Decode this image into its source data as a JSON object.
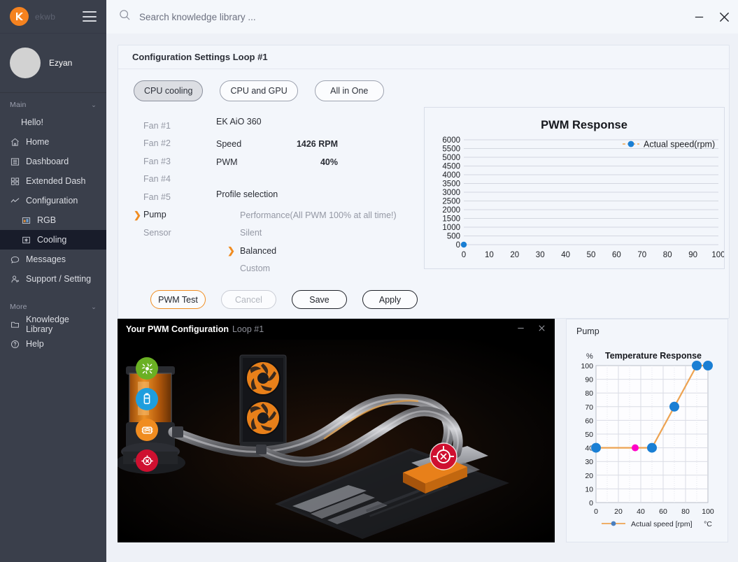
{
  "sidebar": {
    "brand": "ekwb",
    "user": "Ezyan",
    "section_main": "Main",
    "section_more": "More",
    "items_main": [
      {
        "label": "Hello!",
        "icon": "none"
      },
      {
        "label": "Home",
        "icon": "home-icon"
      },
      {
        "label": "Dashboard",
        "icon": "dashboard-icon"
      },
      {
        "label": "Extended Dash",
        "icon": "grid-icon"
      },
      {
        "label": "Configuration",
        "icon": "chart-icon"
      },
      {
        "label": "RGB",
        "icon": "rgb-icon"
      },
      {
        "label": "Cooling",
        "icon": "cooling-icon"
      },
      {
        "label": "Messages",
        "icon": "message-icon"
      },
      {
        "label": "Support / Setting",
        "icon": "support-icon"
      }
    ],
    "items_more": [
      {
        "label": "Knowledge Library",
        "icon": "folder-icon"
      },
      {
        "label": "Help",
        "icon": "help-icon"
      }
    ]
  },
  "topbar": {
    "search_placeholder": "Search knowledge library ...",
    "search_value": "",
    "minimize": "–",
    "close": "✕"
  },
  "config": {
    "title": "Configuration Settings Loop #1",
    "tabs": [
      {
        "label": "CPU cooling",
        "active": true
      },
      {
        "label": "CPU and GPU",
        "active": false
      },
      {
        "label": "All in One",
        "active": false
      }
    ],
    "fans": [
      {
        "label": "Fan #1",
        "selected": false
      },
      {
        "label": "Fan #2",
        "selected": false
      },
      {
        "label": "Fan #3",
        "selected": false
      },
      {
        "label": "Fan #4",
        "selected": false
      },
      {
        "label": "Fan #5",
        "selected": false
      },
      {
        "label": "Pump",
        "selected": true
      },
      {
        "label": "Sensor",
        "selected": false
      }
    ],
    "device_name": "EK AiO 360",
    "rows": [
      {
        "key": "Speed",
        "value": "1426 RPM"
      },
      {
        "key": "PWM",
        "value": "40%"
      }
    ],
    "profile_heading": "Profile selection",
    "profiles": [
      {
        "label": "Performance(All PWM 100% at all time!)",
        "selected": false
      },
      {
        "label": "Silent",
        "selected": false
      },
      {
        "label": "Balanced",
        "selected": true
      },
      {
        "label": "Custom",
        "selected": false
      }
    ],
    "buttons": [
      {
        "label": "PWM Test",
        "style": "orange"
      },
      {
        "label": "Cancel",
        "style": "disabled"
      },
      {
        "label": "Save",
        "style": "normal"
      },
      {
        "label": "Apply",
        "style": "normal"
      }
    ]
  },
  "image_panel": {
    "title_bold": "Your PWM Configuration",
    "title_light": "Loop #1",
    "minimize": "–",
    "close": "✕",
    "icons": [
      {
        "name": "fan-icon",
        "color": "#6ab023"
      },
      {
        "name": "reservoir-icon",
        "color": "#1e9ede"
      },
      {
        "name": "radiator-icon",
        "color": "#f08c20"
      },
      {
        "name": "pump-icon",
        "color": "#cf1030"
      }
    ]
  },
  "pump_panel": {
    "label": "Pump"
  },
  "colors": {
    "accent_orange": "#f08c20",
    "marker_blue": "#1a7fd4",
    "marker_magenta": "#ff00c8",
    "line_orange": "#eda352",
    "sidebar_bg": "#3a3f4b",
    "active_nav": "#181c2a"
  },
  "chart_data": [
    {
      "type": "scatter",
      "id": "pwm-response",
      "title": "PWM Response",
      "xlabel": "",
      "ylabel": "",
      "xlim": [
        0,
        100
      ],
      "ylim": [
        0,
        6000
      ],
      "xticks": [
        0,
        10,
        20,
        30,
        40,
        50,
        60,
        70,
        80,
        90,
        100
      ],
      "yticks": [
        0,
        500,
        1000,
        1500,
        2000,
        2500,
        3000,
        3500,
        4000,
        4500,
        5000,
        5500,
        6000
      ],
      "grid": true,
      "legend": [
        "Actual speed(rpm)"
      ],
      "legend_position": "upper-right-inside",
      "series": [
        {
          "name": "Actual speed(rpm)",
          "x": [
            0
          ],
          "y": [
            0
          ],
          "marker_color": "#1a7fd4",
          "line_color": "#eda352"
        }
      ]
    },
    {
      "type": "line",
      "id": "temperature-response",
      "title": "Temperature Response",
      "xlabel": "°C",
      "ylabel": "%",
      "xlim": [
        0,
        100
      ],
      "ylim": [
        0,
        100
      ],
      "xticks": [
        0,
        20,
        40,
        60,
        80,
        100
      ],
      "yticks": [
        0,
        10,
        20,
        30,
        40,
        50,
        60,
        70,
        80,
        90,
        100
      ],
      "grid": true,
      "legend": [
        "Actual speed [rpm]"
      ],
      "legend_position": "bottom",
      "series": [
        {
          "name": "Actual speed [rpm]",
          "x": [
            0,
            35,
            50,
            70,
            90,
            100
          ],
          "y": [
            40,
            40,
            40,
            70,
            100,
            100
          ],
          "line_color": "#eda352",
          "marker_color": "#1a7fd4",
          "highlight_index": 1,
          "highlight_color": "#ff00c8"
        }
      ]
    }
  ]
}
